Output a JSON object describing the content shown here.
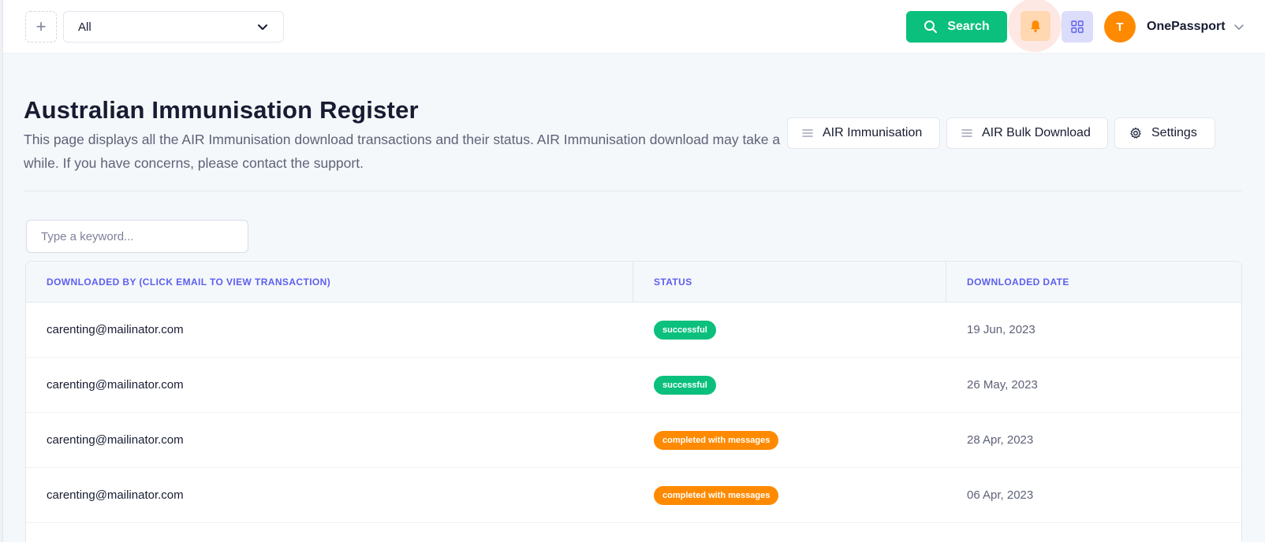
{
  "topbar": {
    "add_icon": "plus-icon",
    "filter_select": {
      "value": "All"
    },
    "search_label": "Search",
    "notifications_icon": "bell-icon",
    "apps_icon": "grid-icon",
    "avatar_initial": "T",
    "user_name": "OnePassport"
  },
  "header": {
    "title": "Australian Immunisation Register",
    "description": "This page displays all the AIR Immunisation download transactions and their status. AIR Immunisation download may take a while. If you have concerns, please contact the support.",
    "buttons": [
      {
        "label": "AIR Immunisation",
        "icon": "list-icon"
      },
      {
        "label": "AIR Bulk Download",
        "icon": "list-icon"
      },
      {
        "label": "Settings",
        "icon": "gear-icon"
      }
    ]
  },
  "search": {
    "placeholder": "Type a keyword..."
  },
  "table": {
    "columns": [
      "DOWNLOADED BY (CLICK EMAIL TO VIEW TRANSACTION)",
      "STATUS",
      "DOWNLOADED DATE"
    ],
    "rows": [
      {
        "email": "carenting@mailinator.com",
        "status": "successful",
        "date": "19 Jun, 2023"
      },
      {
        "email": "carenting@mailinator.com",
        "status": "successful",
        "date": "26 May, 2023"
      },
      {
        "email": "carenting@mailinator.com",
        "status": "completed with messages",
        "date": "28 Apr, 2023"
      },
      {
        "email": "carenting@mailinator.com",
        "status": "completed with messages",
        "date": "06 Apr, 2023"
      }
    ]
  },
  "colors": {
    "primary": "#0bc07d",
    "warning": "#ff8a00",
    "header_text": "#5d5fef"
  }
}
